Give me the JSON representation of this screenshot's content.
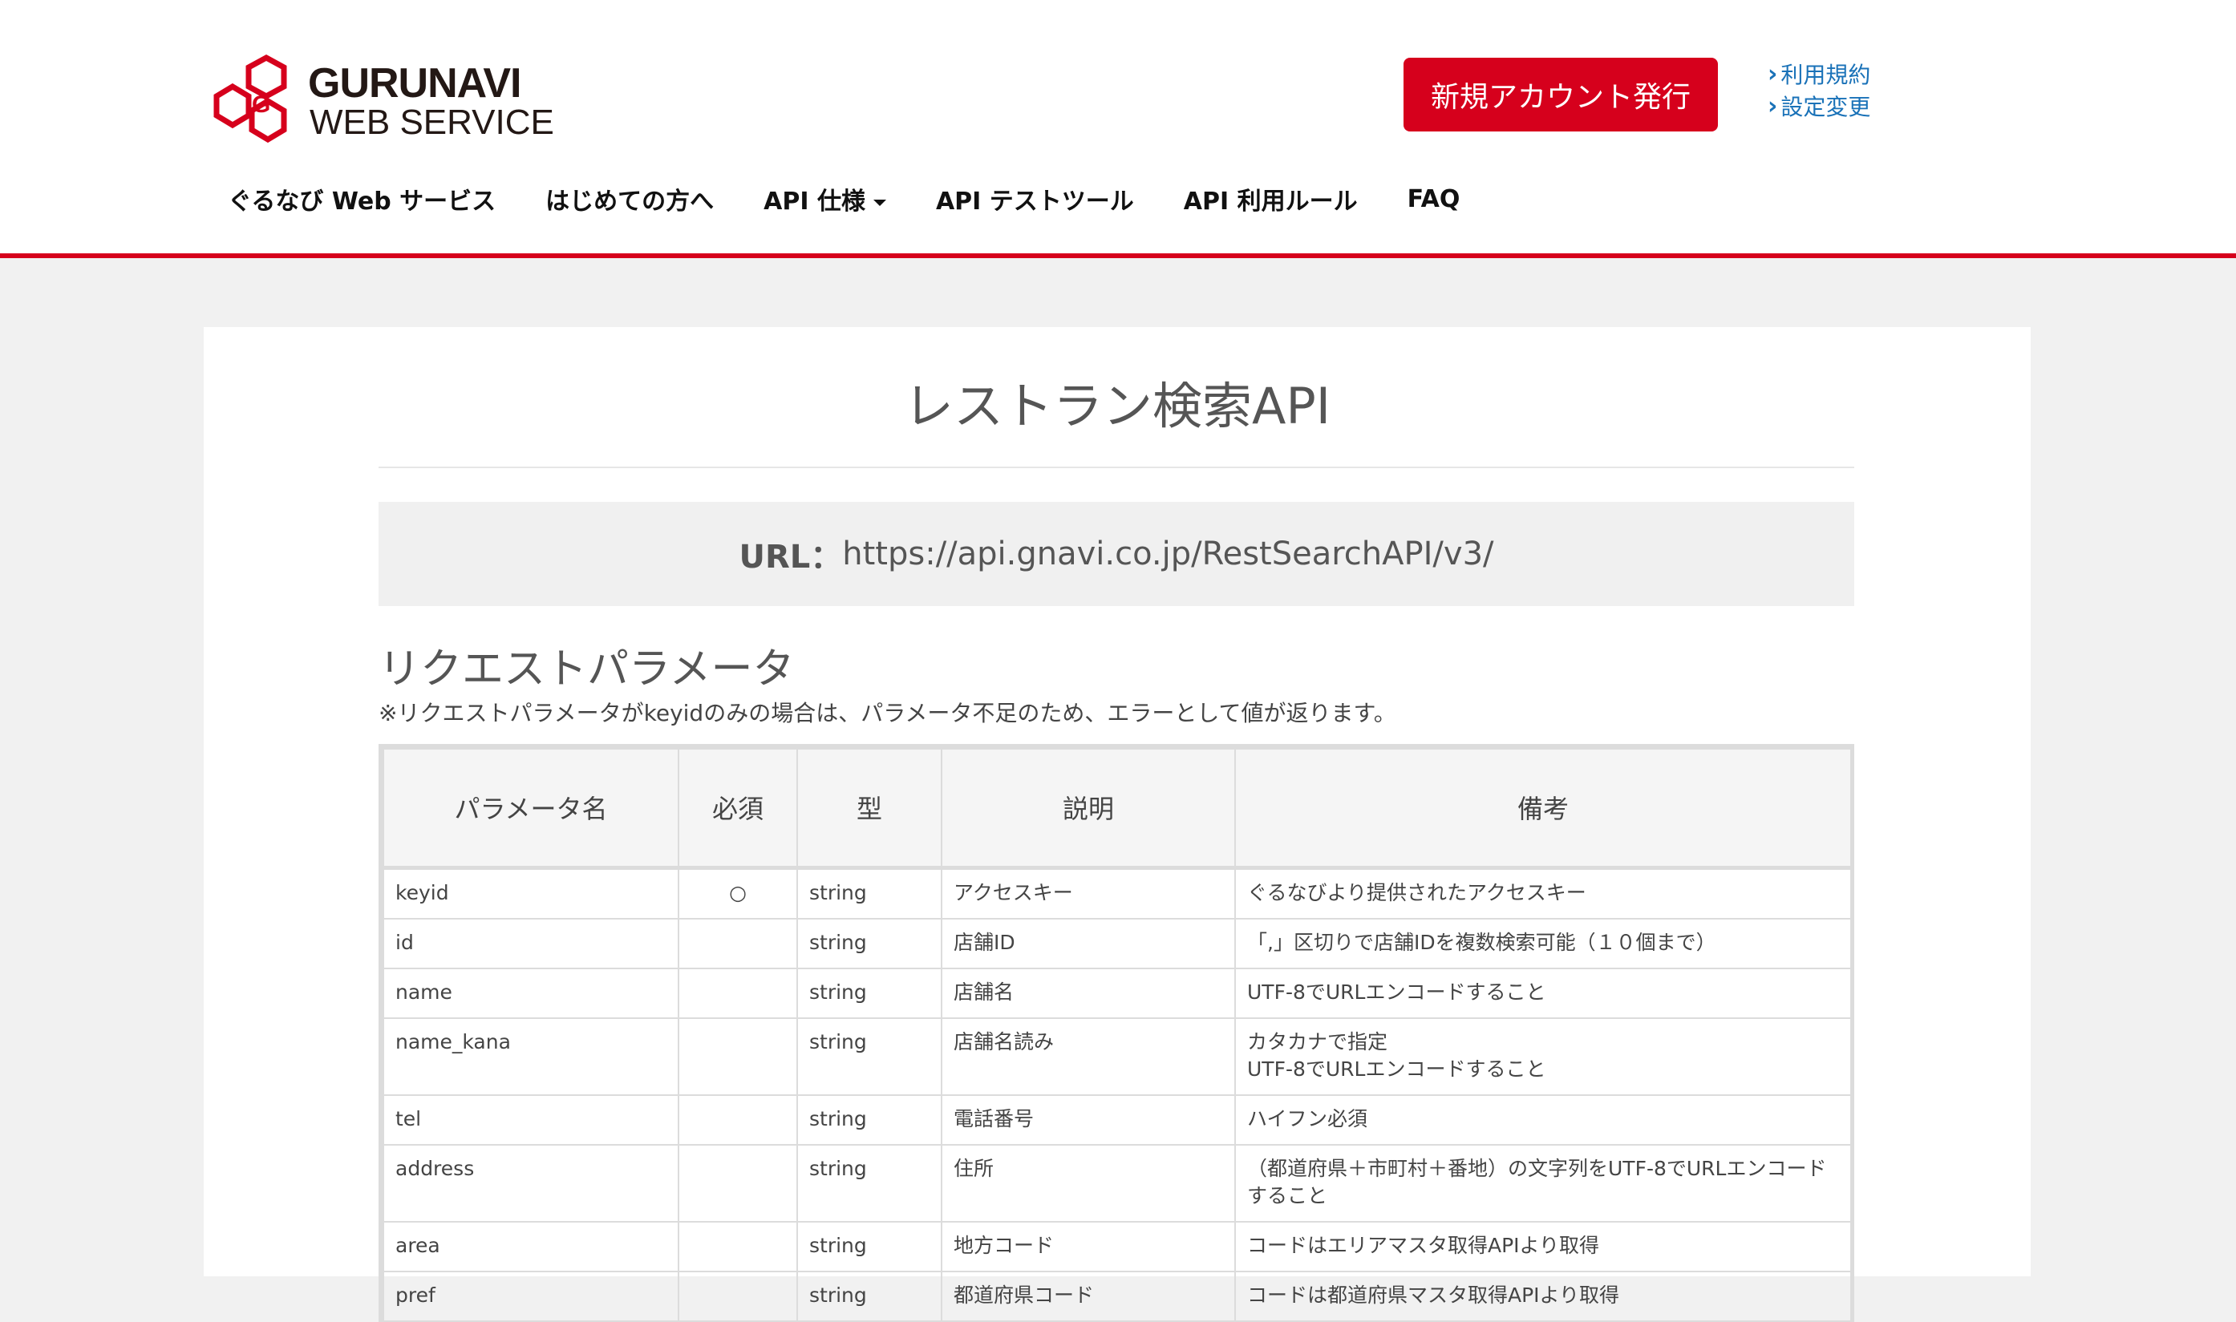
{
  "logo": {
    "line1": "GURUNAVI",
    "line2": "WEB SERVICE"
  },
  "header": {
    "signup_label": "新規アカウント発行",
    "links": [
      {
        "label": "利用規約"
      },
      {
        "label": "設定変更"
      }
    ]
  },
  "nav": {
    "items": [
      {
        "label": "ぐるなび Web サービス"
      },
      {
        "label": "はじめての方へ"
      },
      {
        "label": "API 仕様"
      },
      {
        "label": "API テストツール"
      },
      {
        "label": "API 利用ルール"
      },
      {
        "label": "FAQ"
      }
    ]
  },
  "page": {
    "title": "レストラン検索API",
    "url_label": "URL：",
    "url_value": "https://api.gnavi.co.jp/RestSearchAPI/v3/",
    "section_title": "リクエストパラメータ",
    "note": "※リクエストパラメータがkeyidのみの場合は、パラメータ不足のため、エラーとして値が返ります。"
  },
  "table": {
    "headers": [
      "パラメータ名",
      "必須",
      "型",
      "説明",
      "備考"
    ],
    "rows": [
      {
        "name": "keyid",
        "required": "○",
        "type": "string",
        "desc": "アクセスキー",
        "note": "ぐるなびより提供されたアクセスキー"
      },
      {
        "name": "id",
        "required": "",
        "type": "string",
        "desc": "店舗ID",
        "note": "「,」区切りで店舗IDを複数検索可能（１０個まで）"
      },
      {
        "name": "name",
        "required": "",
        "type": "string",
        "desc": "店舗名",
        "note": "UTF-8でURLエンコードすること"
      },
      {
        "name": "name_kana",
        "required": "",
        "type": "string",
        "desc": "店舗名読み",
        "note": "カタカナで指定\nUTF-8でURLエンコードすること"
      },
      {
        "name": "tel",
        "required": "",
        "type": "string",
        "desc": "電話番号",
        "note": "ハイフン必須"
      },
      {
        "name": "address",
        "required": "",
        "type": "string",
        "desc": "住所",
        "note": "（都道府県＋市町村＋番地）の文字列をUTF-8でURLエンコードすること"
      },
      {
        "name": "area",
        "required": "",
        "type": "string",
        "desc": "地方コード",
        "note": "コードはエリアマスタ取得APIより取得"
      },
      {
        "name": "pref",
        "required": "",
        "type": "string",
        "desc": "都道府県コード",
        "note": "コードは都道府県マスタ取得APIより取得"
      }
    ]
  },
  "colors": {
    "brand_red": "#d6001c",
    "link_blue": "#1a72b8"
  }
}
